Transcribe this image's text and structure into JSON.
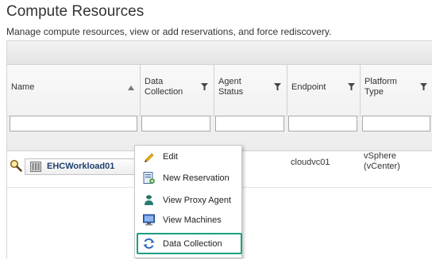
{
  "page": {
    "title": "Compute Resources",
    "description": "Manage compute resources, view or add reservations, and force rediscovery."
  },
  "grid": {
    "columns": [
      {
        "label": "Name",
        "sortable": true
      },
      {
        "label": "Data Collection",
        "filterable": true
      },
      {
        "label": "Agent Status",
        "filterable": true
      },
      {
        "label": "Endpoint",
        "filterable": true
      },
      {
        "label": "Platform Type",
        "filterable": true
      }
    ],
    "rows": [
      {
        "name": "EHCWorkload01",
        "endpoint": "cloudvc01",
        "platform_type": "vSphere (vCenter)"
      }
    ]
  },
  "context_menu": {
    "items": [
      {
        "label": "Edit",
        "icon": "pencil-icon"
      },
      {
        "label": "New Reservation",
        "icon": "new-reservation-icon"
      },
      {
        "label": "View Proxy Agent",
        "icon": "proxy-agent-icon"
      },
      {
        "label": "View Machines",
        "icon": "monitor-icon"
      },
      {
        "label": "Data Collection",
        "icon": "refresh-icon",
        "highlighted": true
      }
    ]
  },
  "colors": {
    "highlight_border": "#1a9e80",
    "link_text": "#1f3f6e"
  }
}
